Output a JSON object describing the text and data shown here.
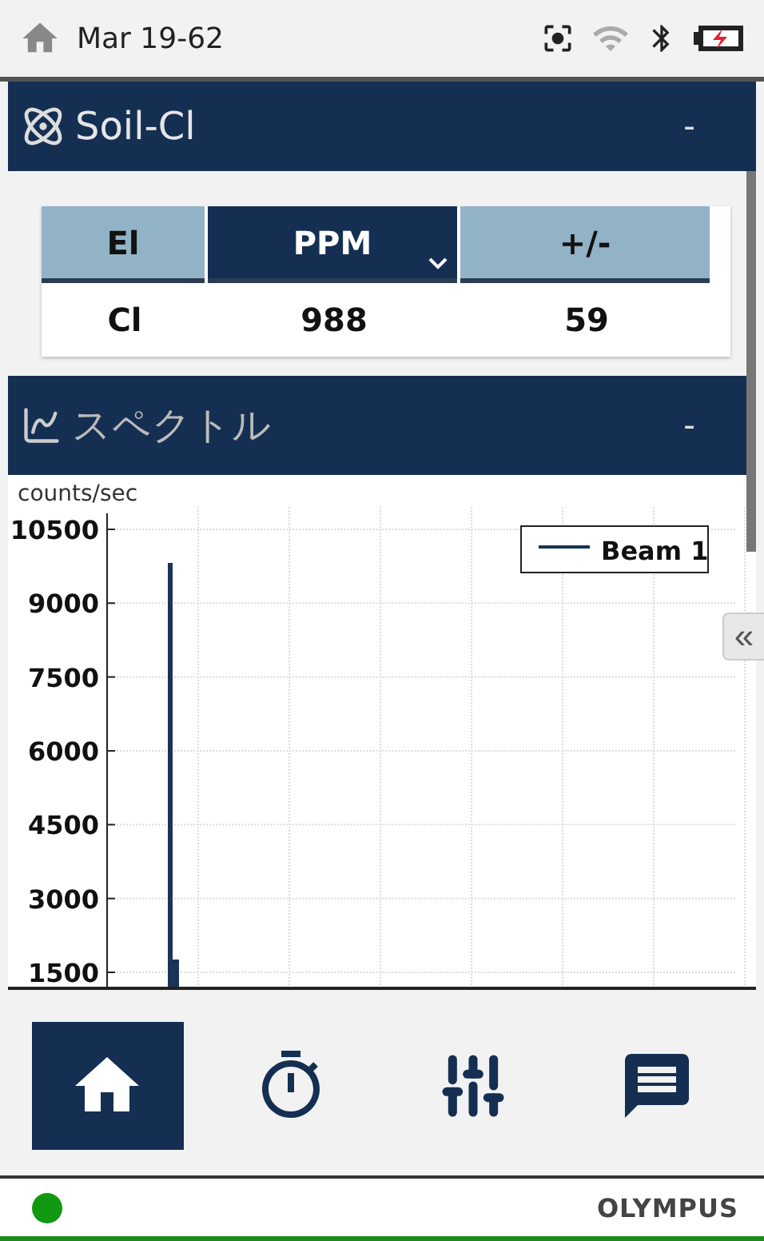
{
  "status_bar": {
    "title": "Mar 19-62"
  },
  "result_panel": {
    "title": "Soil-Cl",
    "collapse": "-",
    "table": {
      "columns": [
        {
          "label": "El",
          "selected": false
        },
        {
          "label": "PPM",
          "selected": true
        },
        {
          "label": "+/-",
          "selected": false
        }
      ],
      "rows": [
        [
          "Cl",
          "988",
          "59"
        ]
      ]
    }
  },
  "spectrum_panel": {
    "title": "スペクトル",
    "collapse": "-",
    "plot": {
      "y_label": "counts/sec",
      "y_ticks": [
        "10500",
        "9000",
        "7500",
        "6000",
        "4500",
        "3000",
        "1500"
      ],
      "legend": [
        {
          "name": "Beam 1"
        }
      ]
    }
  },
  "side_tab": {
    "label": "«"
  },
  "nav": [
    {
      "kind": "home",
      "selected": true
    },
    {
      "kind": "timer",
      "selected": false
    },
    {
      "kind": "settings",
      "selected": false
    },
    {
      "kind": "messages",
      "selected": false
    }
  ],
  "footer": {
    "connected": true,
    "brand": "OLYMPUS"
  }
}
